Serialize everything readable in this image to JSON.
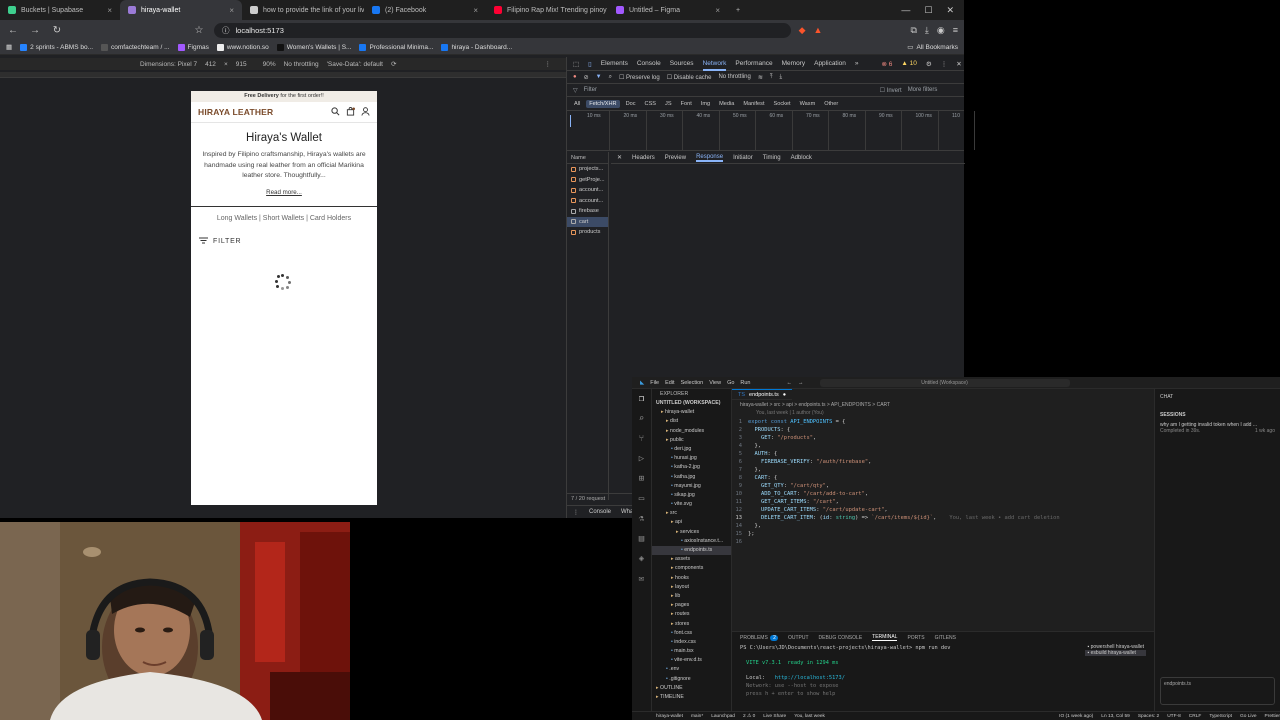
{
  "browser": {
    "tabs": [
      {
        "label": "Buckets | Supabase",
        "color": "#3ecf8e",
        "active": false
      },
      {
        "label": "hiraya-wallet",
        "color": "#9b7bd8",
        "active": true
      },
      {
        "label": "how to provide the link of your livesi",
        "color": "#cccccc",
        "active": false
      },
      {
        "label": "(2) Facebook",
        "color": "#1877f2",
        "active": false
      },
      {
        "label": "Filipino Rap Mix! Trending pinoy",
        "color": "#ff0033",
        "active": false
      },
      {
        "label": "Untitled – Figma",
        "color": "#a259ff",
        "active": false
      }
    ],
    "new_tab": "+",
    "url": "localhost:5173",
    "bookmarks": [
      "2 sprints - ABMS bo...",
      "comfactechteam / ...",
      "Figmas",
      "www.notion.so",
      "Women's Wallets | S...",
      "Professional Minima...",
      "hiraya - Dashboard..."
    ],
    "all_bookmarks": "All Bookmarks"
  },
  "device_toolbar": {
    "dimensions": "Dimensions: Pixel 7",
    "width": "412",
    "height": "915",
    "zoom": "90%",
    "throttle": "No throttling",
    "save_data": "'Save-Data': default"
  },
  "site": {
    "promo_bold": "Free Delivery",
    "promo_rest": "for the first order!!",
    "logo": "HIRAYA LEATHER",
    "title": "Hiraya's Wallet",
    "description": "Inspired by Filipino craftsmanship, Hiraya's wallets are handmade using real leather from an official Marikina leather store. Thoughtfully...",
    "read_more": "Read more...",
    "categories": "Long Wallets  |  Short Wallets  |  Card Holders",
    "filter": "FILTER"
  },
  "devtools": {
    "tabs": [
      "Elements",
      "Console",
      "Sources",
      "Network",
      "Performance",
      "Memory",
      "Application"
    ],
    "active_tab": "Network",
    "preserve_log": "Preserve log",
    "disable_cache": "Disable cache",
    "throttle": "No throttling",
    "filter_placeholder": "Filter",
    "invert": "Invert",
    "more_filters": "More filters",
    "types": [
      "All",
      "Fetch/XHR",
      "Doc",
      "CSS",
      "JS",
      "Font",
      "Img",
      "Media",
      "Manifest",
      "Socket",
      "Wasm",
      "Other"
    ],
    "selected_type": "Fetch/XHR",
    "ticks": [
      "10 ms",
      "20 ms",
      "30 ms",
      "40 ms",
      "50 ms",
      "60 ms",
      "70 ms",
      "80 ms",
      "90 ms",
      "100 ms",
      "110"
    ],
    "name_header": "Name",
    "requests": [
      "projects...",
      "getProje...",
      "account...",
      "account...",
      "firebase",
      "cart",
      "products"
    ],
    "selected_request": "cart",
    "detail_tabs": [
      "Headers",
      "Preview",
      "Response",
      "Initiator",
      "Timing",
      "Adblock"
    ],
    "active_detail": "Response",
    "status": "7 / 20 request",
    "drawer": [
      "Console",
      "What's"
    ],
    "errors": "6",
    "warnings": "10"
  },
  "vscode": {
    "menu": [
      "File",
      "Edit",
      "Selection",
      "View",
      "Go",
      "Run"
    ],
    "search": "Untitled (Workspace)",
    "explorer_title": "EXPLORER",
    "workspace": "UNTITLED (WORKSPACE)",
    "tree": [
      "hiraya-wallet",
      "dist",
      "node_modules",
      "public",
      "deri.jpg",
      "hurasi.jpg",
      "katha-2.jpg",
      "katha.jpg",
      "mayumi.jpg",
      "sikap.jpg",
      "vite.svg",
      "src",
      "api",
      "services",
      "axiosInstance.t...",
      "endpoints.ts",
      "assets",
      "components",
      "hooks",
      "layout",
      "lib",
      "pages",
      "routes",
      "stores",
      "font.css",
      "index.css",
      "main.tsx",
      "vite-env.d.ts",
      ".env",
      ".gitignore",
      "OUTLINE",
      "TIMELINE"
    ],
    "tab": "endpoints.ts",
    "breadcrumb": "hiraya-wallet > src > api > endpoints.ts > API_ENDPOINTS > CART",
    "blame": "You, last week | 1 author (You)",
    "code": [
      "export const API_ENDPOINTS = {",
      "  PRODUCTS: {",
      "    GET: \"/products\",",
      "  },",
      "  AUTH: {",
      "    FIREBASE_VERIFY: \"/auth/firebase\",",
      "  },",
      "  CART: {",
      "    GET_QTY: \"/cart/qty\",",
      "    ADD_TO_CART: \"/cart/add-to-cart\",",
      "    GET_CART_ITEMS: \"/cart\",",
      "    UPDATE_CART_ITEMS: \"/cart/update-cart\",",
      "    DELETE_CART_ITEM: (id: string) => `/cart/items/${id}`,",
      "  },",
      "};",
      ""
    ],
    "inline_hint": "You, last week • add cart deletion",
    "panel_tabs": [
      "PROBLEMS",
      "OUTPUT",
      "DEBUG CONSOLE",
      "TERMINAL",
      "PORTS",
      "GITLENS"
    ],
    "active_panel": "TERMINAL",
    "problems_count": "2",
    "terminal": {
      "prompt": "PS C:\\Users\\JD\\Documents\\react-projects\\hiraya-wallet> npm run dev",
      "vite": "VITE v7.3.1  ready in 1294 ms",
      "local_label": "Local:",
      "local_url": "http://localhost:5173/",
      "network": "Network: use --host to expose",
      "help": "press h + enter to show help"
    },
    "terminals": [
      "powershell hiraya-wallet",
      "esbuild hiraya-wallet"
    ],
    "chat_title": "CHAT",
    "sessions": "SESSIONS",
    "session_text": "why am I getting invalid token when I add ...",
    "session_status": "Completed in 39s.",
    "session_time": "1 wk ago",
    "chat_file": "endpoints.ts",
    "status_items": [
      "hiraya-wallet",
      "main*",
      "Launchpad",
      "2 ⚠ 0",
      "Live Share",
      "You, last week",
      "IO (1 week ago)",
      "Ln 13, Col 59",
      "Spaces: 2",
      "UTF-8",
      "CRLF",
      "TypeScript",
      "Go Live",
      "Prettier"
    ]
  }
}
